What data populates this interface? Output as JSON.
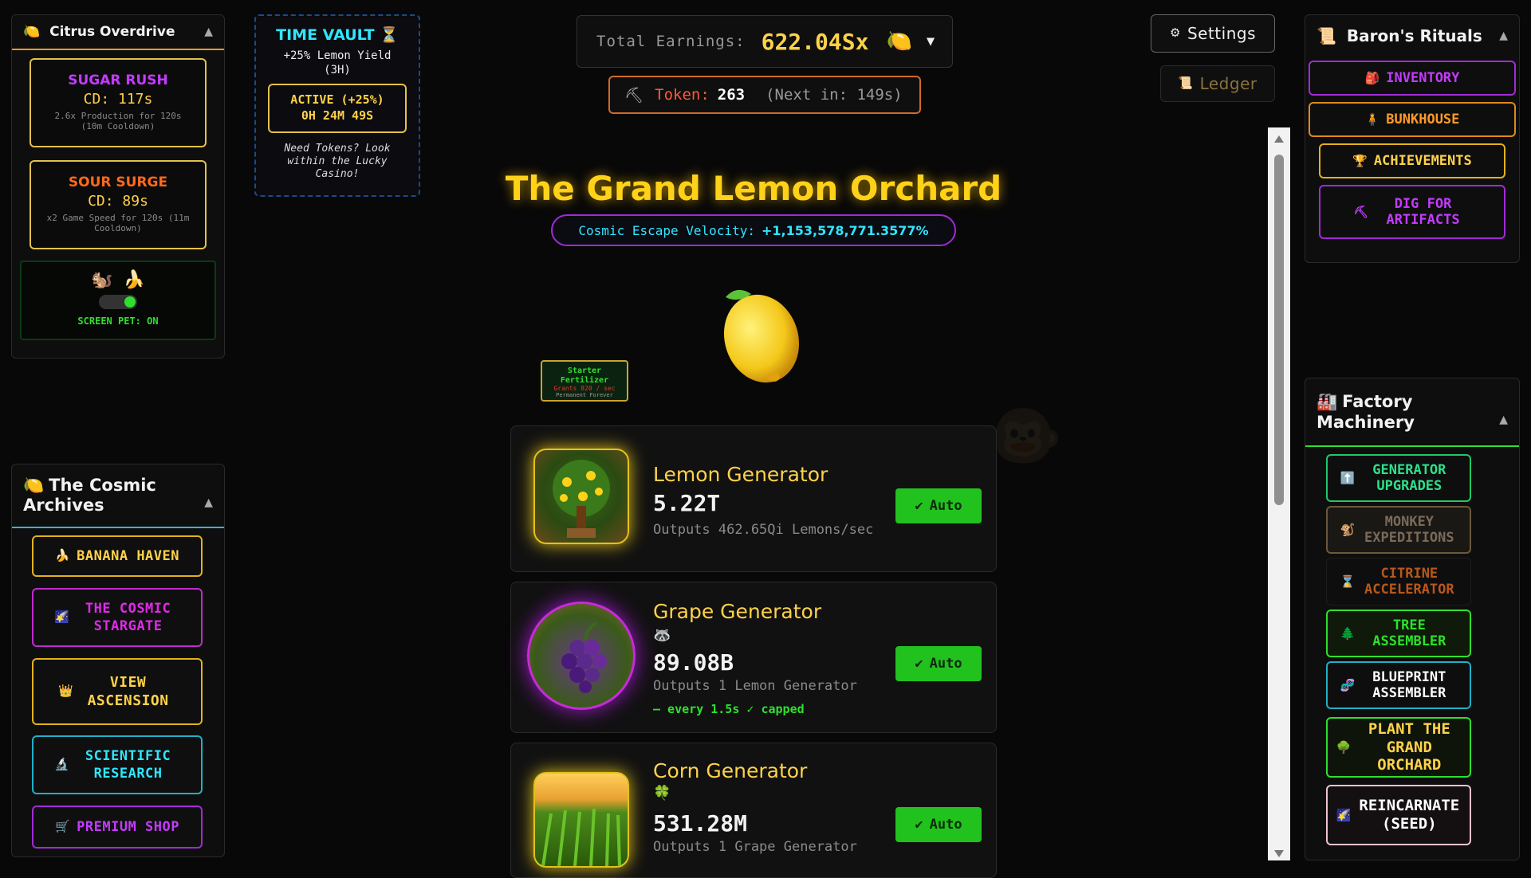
{
  "citrus_panel": {
    "title": "Citrus Overdrive",
    "title_icon": "lemon-icon",
    "collapse_glyph": "▲",
    "sugar_rush": {
      "name": "SUGAR RUSH",
      "cooldown": "CD: 117s",
      "desc": "2.6x Production for 120s (10m Cooldown)"
    },
    "sour_surge": {
      "name": "SOUR SURGE",
      "cooldown": "CD: 89s",
      "desc": "x2 Game Speed for 120s (11m Cooldown)"
    },
    "pet": {
      "emojis": "🐿️ 🍌",
      "label": "SCREEN PET: ON"
    }
  },
  "time_vault": {
    "title": "TIME VAULT ⏳",
    "bonus": "+25% Lemon Yield (3H)",
    "status_line1": "ACTIVE (+25%)",
    "status_line2": "0H 24M 49S",
    "note": "Need Tokens? Look within the Lucky Casino!"
  },
  "header": {
    "earnings_label": "Total Earnings:",
    "earnings_value": "622.04Sx",
    "earnings_icon": "🍋",
    "dropdown_glyph": "▼",
    "token_icon": "⛏",
    "token_label": "Token:",
    "token_value": "263",
    "token_next": "(Next in: 149s)",
    "settings_label": "Settings",
    "ledger_label": "Ledger"
  },
  "main": {
    "title": "The Grand Lemon Orchard",
    "velocity_label": "Cosmic Escape Velocity:",
    "velocity_value": "+1,153,578,771.3577%",
    "fertilizer_line1": "Starter Fertilizer",
    "fertilizer_line2": "Grants 820 / sec",
    "fertilizer_line3": "Permanent Forever"
  },
  "generators": [
    {
      "name": "Lemon Generator",
      "count": "5.22T",
      "output": "Outputs 462.65Qi Lemons/sec",
      "extra": "",
      "badge": "",
      "auto": "Auto"
    },
    {
      "name": "Grape Generator",
      "count": "89.08B",
      "output": "Outputs 1 Lemon Generator",
      "extra": "— every 1.5s ✓ capped",
      "badge": "🦝",
      "auto": "Auto"
    },
    {
      "name": "Corn Generator",
      "count": "531.28M",
      "output": "Outputs 1 Grape Generator",
      "extra": "",
      "badge": "🍀",
      "auto": "Auto"
    }
  ],
  "archives": {
    "title_line1": "The Cosmic",
    "title_line2": "Archives",
    "collapse_glyph": "▲",
    "items": [
      {
        "label": "BANANA HAVEN",
        "icon": "🍌"
      },
      {
        "label": "THE COSMIC STARGATE",
        "icon": "🌠"
      },
      {
        "label": "VIEW ASCENSION",
        "icon": "👑"
      },
      {
        "label": "SCIENTIFIC RESEARCH",
        "icon": "🔬"
      },
      {
        "label": "PREMIUM SHOP",
        "icon": "🛒"
      }
    ]
  },
  "rituals": {
    "title": "Baron's Rituals",
    "collapse_glyph": "▲",
    "items": [
      {
        "label": "INVENTORY",
        "icon": "🎒"
      },
      {
        "label": "BUNKHOUSE",
        "icon": "🧍"
      },
      {
        "label": "ACHIEVEMENTS",
        "icon": "🏆"
      },
      {
        "label": "DIG FOR ARTIFACTS",
        "icon": "⛏"
      }
    ]
  },
  "factory": {
    "title_line1": "Factory",
    "title_line2": "Machinery",
    "collapse_glyph": "▲",
    "items": [
      {
        "label": "GENERATOR UPGRADES",
        "icon": "⬆️"
      },
      {
        "label": "MONKEY EXPEDITIONS",
        "icon": "🐒"
      },
      {
        "label": "CITRINE ACCELERATOR",
        "icon": "⌛"
      },
      {
        "label": "TREE ASSEMBLER",
        "icon": "🌲"
      },
      {
        "label": "BLUEPRINT ASSEMBLER",
        "icon": "🧬"
      },
      {
        "label": "PLANT THE GRAND ORCHARD",
        "icon": "🌳"
      },
      {
        "label": "REINCARNATE (SEED)",
        "icon": "🌠"
      }
    ]
  },
  "colors": {
    "gold": "#ffd24a",
    "accent_orange": "#e89a2a",
    "auto_green": "#22c21e",
    "cyan": "#2fe6ff",
    "magenta": "#d02bd8"
  }
}
